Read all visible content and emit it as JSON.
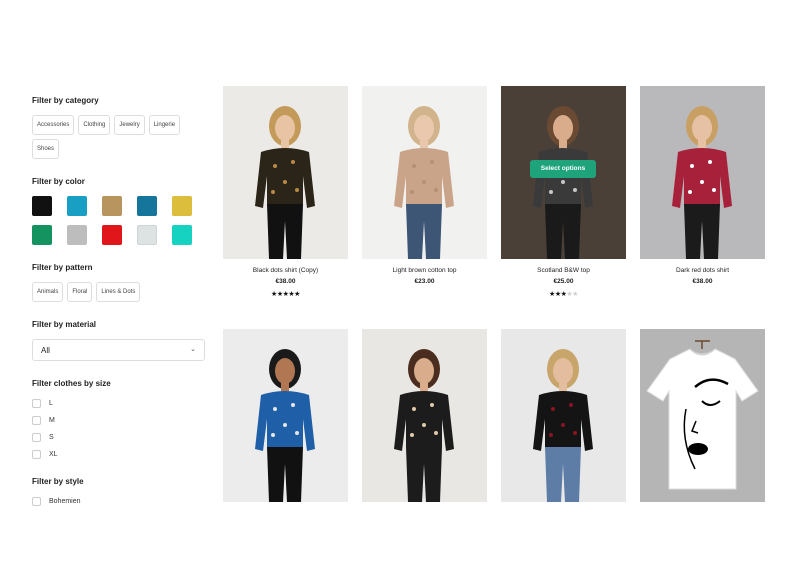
{
  "filters": {
    "category": {
      "title": "Filter by category",
      "options": [
        "Accessories",
        "Clothing",
        "Jewelry",
        "Lingerie",
        "Shoes"
      ]
    },
    "color": {
      "title": "Filter by color",
      "swatches": [
        "#111111",
        "#1a9fc4",
        "#b8955e",
        "#15759a",
        "#dcbd3c",
        "#14925f",
        "#bdbdbd",
        "#e0161a",
        "#dde3e3",
        "#16d2c0"
      ]
    },
    "pattern": {
      "title": "Filter by pattern",
      "options": [
        "Animals",
        "Floral",
        "Lines & Dots"
      ]
    },
    "material": {
      "title": "Filter by material",
      "selected": "All"
    },
    "size": {
      "title": "Filter clothes by size",
      "options": [
        "L",
        "M",
        "S",
        "XL"
      ]
    },
    "style": {
      "title": "Filter by style",
      "options": [
        "Bohemien"
      ]
    }
  },
  "products": [
    {
      "name": "Black dots shirt (Copy)",
      "price": "€38.00",
      "rating": 5,
      "bg": "#eceae6",
      "top": "#2b2418",
      "accent": "#b98b45",
      "bottom": "#111111",
      "hair": "#c49a5a",
      "skin": "#e8c3a4"
    },
    {
      "name": "Light brown cotton top",
      "price": "€23.00",
      "rating": null,
      "bg": "#f1f1ef",
      "top": "#caa489",
      "accent": "#b68f72",
      "bottom": "#3d5676",
      "hair": "#d2b48c",
      "skin": "#e9c8ad"
    },
    {
      "name": "Scotland B&W top",
      "price": "€25.00",
      "rating": 3,
      "bg": "#4a4038",
      "top": "#3a3a3a",
      "accent": "#c7c7c7",
      "bottom": "#1a1a1a",
      "hair": "#6b4a34",
      "skin": "#d9ad8c",
      "hover_button": "Select options"
    },
    {
      "name": "Dark red dots shirt",
      "price": "€38.00",
      "rating": null,
      "bg": "#b9b9bb",
      "top": "#a8213a",
      "accent": "#ffffff",
      "bottom": "#1b1b1b",
      "hair": "#c9a064",
      "skin": "#e7c1a3"
    },
    {
      "bg": "#ececec",
      "top": "#1e5fa8",
      "accent": "#e6e6e6",
      "bottom": "#111111",
      "hair": "#1a1a1a",
      "skin": "#b07752"
    },
    {
      "bg": "#e9e7e4",
      "top": "#1c1c1c",
      "accent": "#e0c9a6",
      "bottom": "#1c1c1c",
      "hair": "#4a2d1e",
      "skin": "#d9ad8c"
    },
    {
      "bg": "#e8e8e8",
      "top": "#141414",
      "accent": "#8a1424",
      "bottom": "#5d7da6",
      "hair": "#c8a56a",
      "skin": "#e4bd9e"
    },
    {
      "bg": "#b5b5b5",
      "top": "#ffffff",
      "accent": "#000000",
      "bottom": "#b5b5b5",
      "hair": "#6b4a2e",
      "skin": "#ffffff"
    }
  ]
}
